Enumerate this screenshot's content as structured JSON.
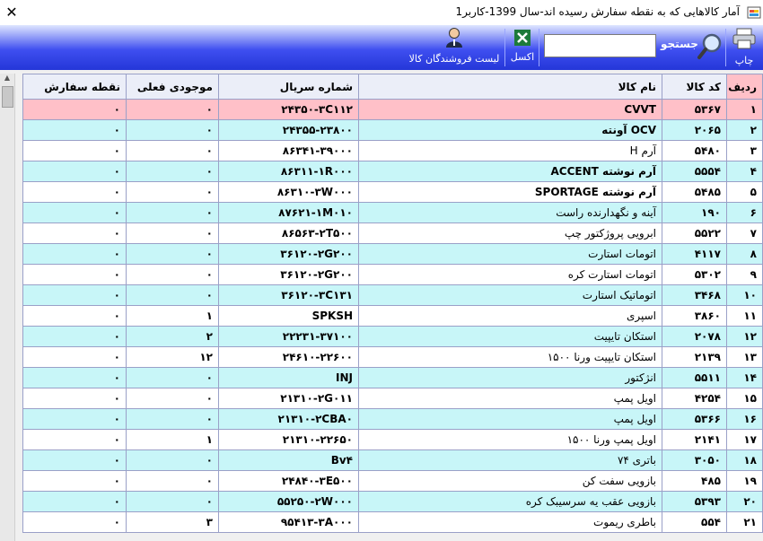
{
  "window": {
    "title": "آمار کالاهایی که به نقطه سفارش رسیده اند-سال 1399-کاربر1",
    "close": "✕"
  },
  "toolbar": {
    "print_label": "چاپ",
    "search_label": "جستجو",
    "search_value": "",
    "excel_label": "اکسل",
    "suppliers_label": "لیست فروشندگان کالا"
  },
  "table": {
    "headers": {
      "row": "ردیف",
      "code": "کد کالا",
      "name": "نام کالا",
      "serial": "شماره سریال",
      "stock": "موجودی فعلی",
      "order_point": "نقطه سفارش"
    },
    "rows": [
      {
        "row": "۱",
        "code": "۵۳۶۷",
        "name": "CVVT",
        "serial": "۲۴۳۵۰-۳C۱۱۲",
        "stock": "۰",
        "order_point": "۰"
      },
      {
        "row": "۲",
        "code": "۲۰۶۵",
        "name": "OCV آونته",
        "serial": "۲۴۳۵۵-۲۳۸۰۰",
        "stock": "۰",
        "order_point": "۰"
      },
      {
        "row": "۳",
        "code": "۵۴۸۰",
        "name": "آرم H",
        "serial": "۸۶۳۴۱-۳۹۰۰۰",
        "stock": "۰",
        "order_point": "۰"
      },
      {
        "row": "۴",
        "code": "۵۵۵۴",
        "name": "آرم نوشته ACCENT",
        "serial": "۸۶۳۱۱-۱R۰۰۰",
        "stock": "۰",
        "order_point": "۰"
      },
      {
        "row": "۵",
        "code": "۵۴۸۵",
        "name": "آرم نوشته SPORTAGE",
        "serial": "۸۶۳۱۰-۳W۰۰۰",
        "stock": "۰",
        "order_point": "۰"
      },
      {
        "row": "۶",
        "code": "۱۹۰",
        "name": "آینه و نگهدارنده راست",
        "serial": "۸۷۶۲۱-۱M۰۱۰",
        "stock": "۰",
        "order_point": "۰"
      },
      {
        "row": "۷",
        "code": "۵۵۲۲",
        "name": "ابرویی پروژکتور چپ",
        "serial": "۸۶۵۶۳-۲T۵۰۰",
        "stock": "۰",
        "order_point": "۰"
      },
      {
        "row": "۸",
        "code": "۴۱۱۷",
        "name": "اتومات استارت",
        "serial": "۳۶۱۲۰-۲G۲۰۰",
        "stock": "۰",
        "order_point": "۰"
      },
      {
        "row": "۹",
        "code": "۵۳۰۲",
        "name": "اتومات استارت کره",
        "serial": "۳۶۱۲۰-۲G۲۰۰",
        "stock": "۰",
        "order_point": "۰"
      },
      {
        "row": "۱۰",
        "code": "۳۴۶۸",
        "name": "اتوماتیک استارت",
        "serial": "۳۶۱۲۰-۳C۱۳۱",
        "stock": "۰",
        "order_point": "۰"
      },
      {
        "row": "۱۱",
        "code": "۳۸۶۰",
        "name": "اسپری",
        "serial": "SPKSH",
        "stock": "۱",
        "order_point": "۰"
      },
      {
        "row": "۱۲",
        "code": "۲۰۷۸",
        "name": "استکان تایپیت",
        "serial": "۲۲۲۳۱-۳۷۱۰۰",
        "stock": "۲",
        "order_point": "۰"
      },
      {
        "row": "۱۳",
        "code": "۲۱۳۹",
        "name": "استکان تایپیت ورنا ۱۵۰۰",
        "serial": "۲۴۶۱۰-۲۲۶۰۰",
        "stock": "۱۲",
        "order_point": "۰"
      },
      {
        "row": "۱۴",
        "code": "۵۵۱۱",
        "name": "انژکتور",
        "serial": "INJ",
        "stock": "۰",
        "order_point": "۰"
      },
      {
        "row": "۱۵",
        "code": "۴۲۵۴",
        "name": "اویل پمپ",
        "serial": "۲۱۳۱۰-۲G۰۱۱",
        "stock": "۰",
        "order_point": "۰"
      },
      {
        "row": "۱۶",
        "code": "۵۳۶۶",
        "name": "اویل پمپ",
        "serial": "۲۱۳۱۰-۲CBA۰",
        "stock": "۰",
        "order_point": "۰"
      },
      {
        "row": "۱۷",
        "code": "۲۱۴۱",
        "name": "اویل پمپ ورنا ۱۵۰۰",
        "serial": "۲۱۳۱۰-۲۲۶۵۰",
        "stock": "۱",
        "order_point": "۰"
      },
      {
        "row": "۱۸",
        "code": "۳۰۵۰",
        "name": "باتری ۷۴",
        "serial": "Bv۴",
        "stock": "۰",
        "order_point": "۰"
      },
      {
        "row": "۱۹",
        "code": "۴۸۵",
        "name": "بازویی سفت کن",
        "serial": "۲۴۸۴۰-۳E۵۰۰",
        "stock": "۰",
        "order_point": "۰"
      },
      {
        "row": "۲۰",
        "code": "۵۳۹۳",
        "name": "بازویی عقب یه سرسیبک کره",
        "serial": "۵۵۲۵۰-۲W۰۰۰",
        "stock": "۰",
        "order_point": "۰"
      },
      {
        "row": "۲۱",
        "code": "۵۵۴",
        "name": "باطری ریموت",
        "serial": "۹۵۴۱۳-۳A۰۰۰",
        "stock": "۳",
        "order_point": "۰"
      }
    ]
  },
  "colors": {
    "accent": "#2436d8",
    "row_alt": "#c8f6f8",
    "selected": "#ffc0c8"
  },
  "icons": [
    "printer-icon",
    "magnifier-icon",
    "excel-icon",
    "user-icon",
    "close-icon",
    "app-icon"
  ]
}
